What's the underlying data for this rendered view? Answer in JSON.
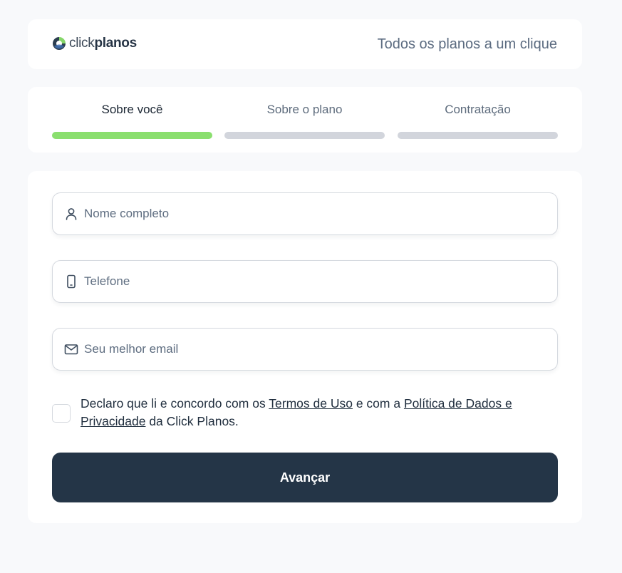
{
  "header": {
    "logo_light": "click",
    "logo_bold": "planos",
    "tagline": "Todos os planos a um clique"
  },
  "steps": [
    {
      "label": "Sobre você",
      "active": true
    },
    {
      "label": "Sobre o plano",
      "active": false
    },
    {
      "label": "Contratação",
      "active": false
    }
  ],
  "form": {
    "name_placeholder": "Nome completo",
    "phone_placeholder": "Telefone",
    "email_placeholder": "Seu melhor email",
    "consent": {
      "prefix": "Declaro que li e concordo com os ",
      "terms_link": "Termos de Uso",
      "middle": " e com a ",
      "privacy_link": "Política de Dados e Privacidade",
      "suffix": " da Click Planos."
    },
    "submit_label": "Avançar"
  },
  "colors": {
    "progress_active": "#8adf6e",
    "progress_inactive": "#d2d5dc",
    "button_bg": "#243547"
  },
  "icons": [
    "logo-mark",
    "user-icon",
    "smartphone-icon",
    "mail-icon"
  ]
}
